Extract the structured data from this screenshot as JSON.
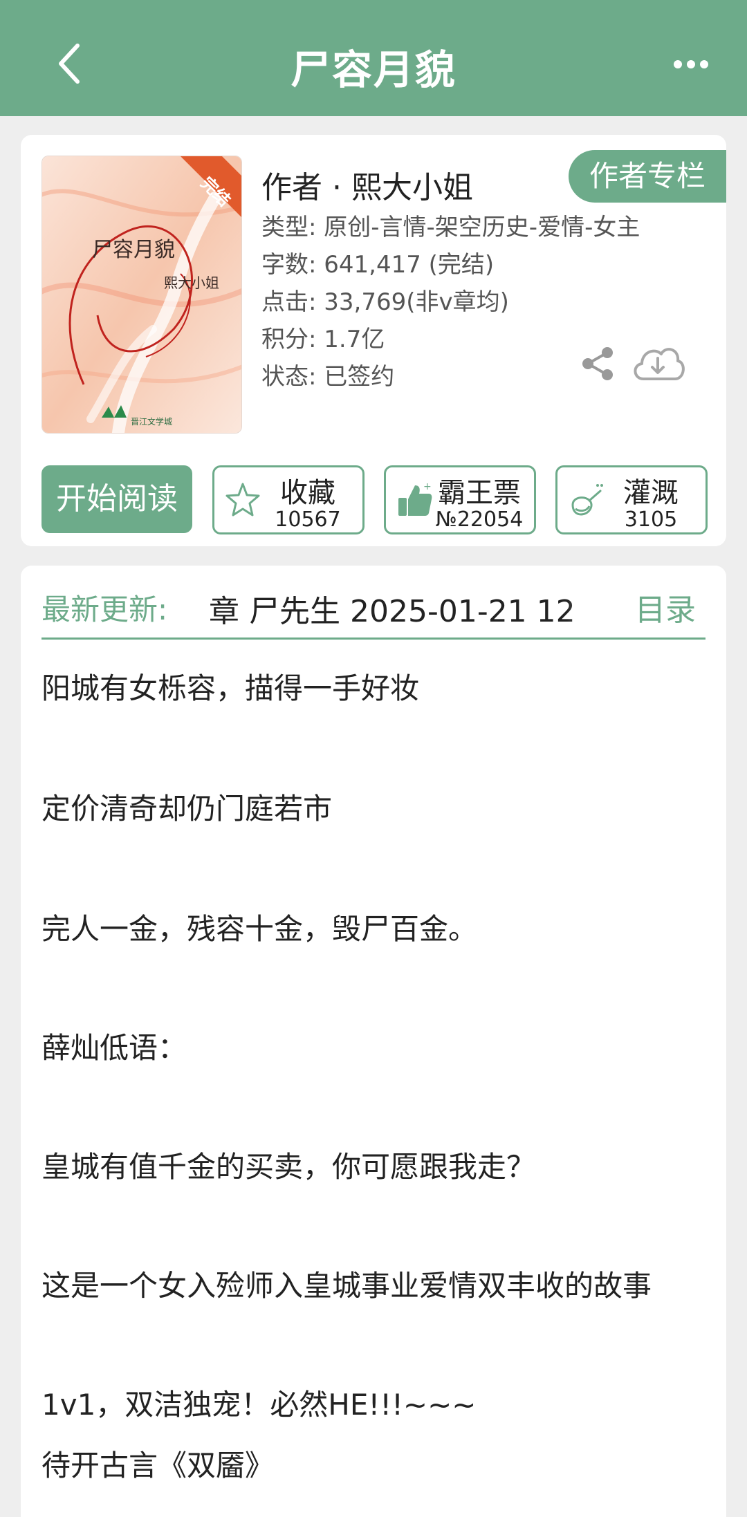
{
  "header": {
    "title": "尸容月貌"
  },
  "book": {
    "cover_title": "尸容月貌",
    "cover_author": "熙大小姐",
    "cover_badge": "完结",
    "cover_publisher": "晋江文学城",
    "author_line": "作者 · 熙大小姐",
    "author_column_label": "作者专栏",
    "type": "类型: 原创-言情-架空历史-爱情-女主",
    "word_count": "字数: 641,417 (完结)",
    "clicks": "点击: 33,769(非v章均)",
    "score": "积分: 1.7亿",
    "status": "状态: 已签约"
  },
  "actions": {
    "read_label": "开始阅读",
    "favorite": {
      "label": "收藏",
      "count": "10567"
    },
    "overlord": {
      "label": "霸王票",
      "count": "№22054"
    },
    "nourish": {
      "label": "灌溉",
      "count": "3105"
    }
  },
  "latest": {
    "label": "最新更新:",
    "text": "章 尸先生 2025-01-21 12",
    "toc_label": "目录"
  },
  "synopsis": [
    "阳城有女栎容，描得一手好妆",
    "定价清奇却仍门庭若市",
    "完人一金，残容十金，毁尸百金。",
    "薛灿低语：",
    "皇城有值千金的买卖，你可愿跟我走？",
    "这是一个女入殓师入皇城事业爱情双丰收的故事",
    "1v1，双洁独宠！必然HE!!!~~~",
    "待开古言《双靥》"
  ],
  "colors": {
    "accent": "#6dab8a",
    "background": "#eeeeee"
  },
  "icons": [
    "back-arrow-icon",
    "more-dots-icon",
    "share-icon",
    "cloud-download-icon",
    "star-icon",
    "thumbs-up-icon",
    "watering-can-icon"
  ]
}
